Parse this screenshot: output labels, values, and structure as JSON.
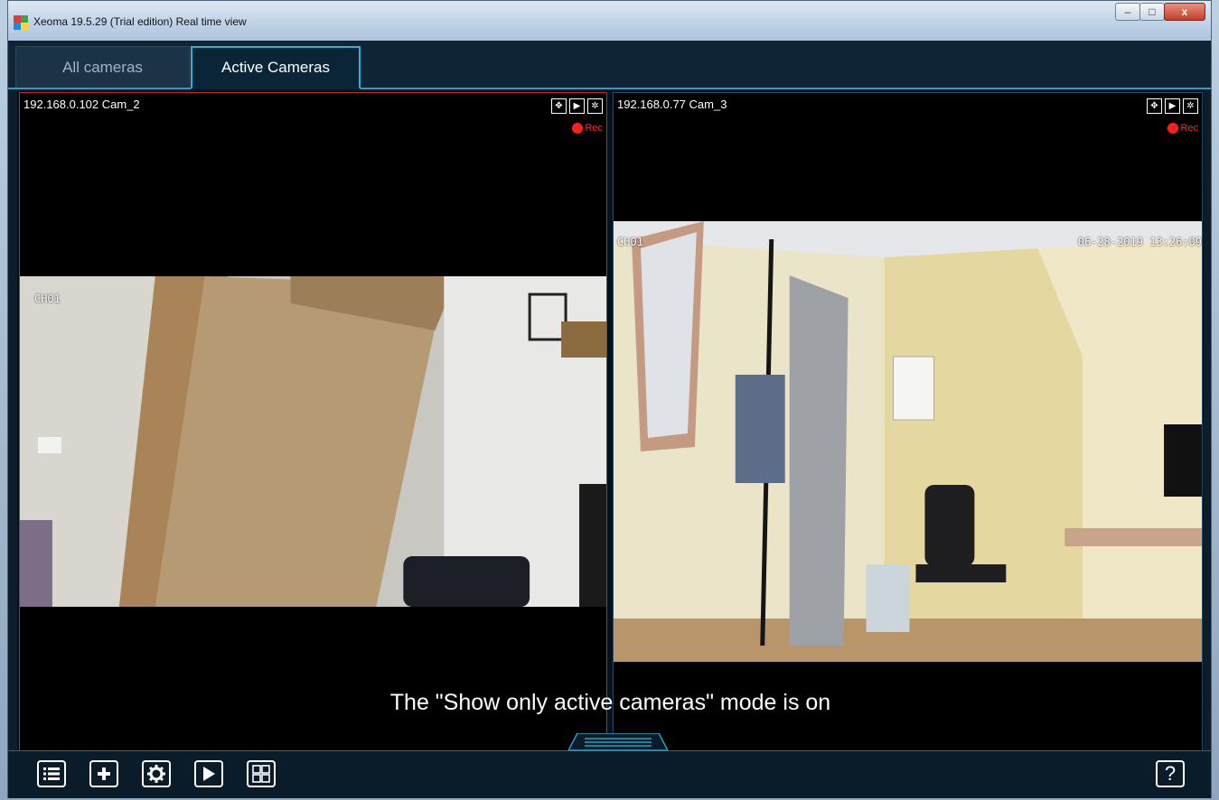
{
  "window": {
    "title": "Xeoma 19.5.29 (Trial edition) Real time view",
    "controls": {
      "minimize": "–",
      "maximize": "□",
      "close": "x"
    }
  },
  "tabs": [
    {
      "label": "All cameras",
      "active": false
    },
    {
      "label": "Active Cameras",
      "active": true
    }
  ],
  "cameras": [
    {
      "label": "192.168.0.102 Cam_2",
      "rec": "Rec",
      "overlay": "CH01",
      "selected": true
    },
    {
      "label": "192.168.0.77 Cam_3",
      "rec": "Rec",
      "overlay_channel": "CH01",
      "overlay_datetime": "06-28-2019 13:26:09",
      "selected": false
    }
  ],
  "status_text": "The \"Show only active cameras\" mode is on",
  "toolbar": {
    "buttons": [
      "list-icon",
      "add-icon",
      "settings-icon",
      "play-icon",
      "layout-grid-icon"
    ],
    "help": "?"
  },
  "colors": {
    "accent": "#2ab3d6",
    "rec": "#ff1e1e",
    "selected_border": "#c0282a"
  }
}
